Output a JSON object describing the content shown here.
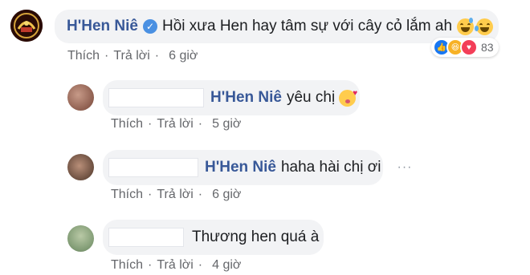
{
  "main_comment": {
    "author": "H'Hen Niê",
    "verified": true,
    "text": "Hồi xưa Hen hay tâm sự với cây cỏ lắm ah",
    "emojis": [
      "grinning-sweat-emoji",
      "tears-of-joy-emoji"
    ],
    "reactions": {
      "icons": [
        "like-reaction-icon",
        "haha-reaction-icon",
        "love-reaction-icon"
      ],
      "count": "83"
    },
    "actions": {
      "like": "Thích",
      "reply": "Trả lời",
      "time": "6 giờ",
      "separator": "·"
    }
  },
  "replies": [
    {
      "mention": "H'Hen Niê",
      "text": "yêu chị",
      "emoji": "kissing-heart-emoji",
      "actions": {
        "like": "Thích",
        "reply": "Trả lời",
        "time": "5 giờ",
        "separator": "·"
      }
    },
    {
      "mention": "H'Hen Niê",
      "text": "haha hài chị ơi",
      "more_label": "···",
      "actions": {
        "like": "Thích",
        "reply": "Trả lời",
        "time": "6 giờ",
        "separator": "·"
      }
    },
    {
      "mention": "",
      "text": "Thương hen quá à",
      "actions": {
        "like": "Thích",
        "reply": "Trả lời",
        "time": "4 giờ",
        "separator": "·"
      }
    }
  ],
  "colors": {
    "author": "#385898",
    "bubble": "#f2f3f5",
    "meta": "#65676b",
    "verified": "#4a90e2"
  }
}
